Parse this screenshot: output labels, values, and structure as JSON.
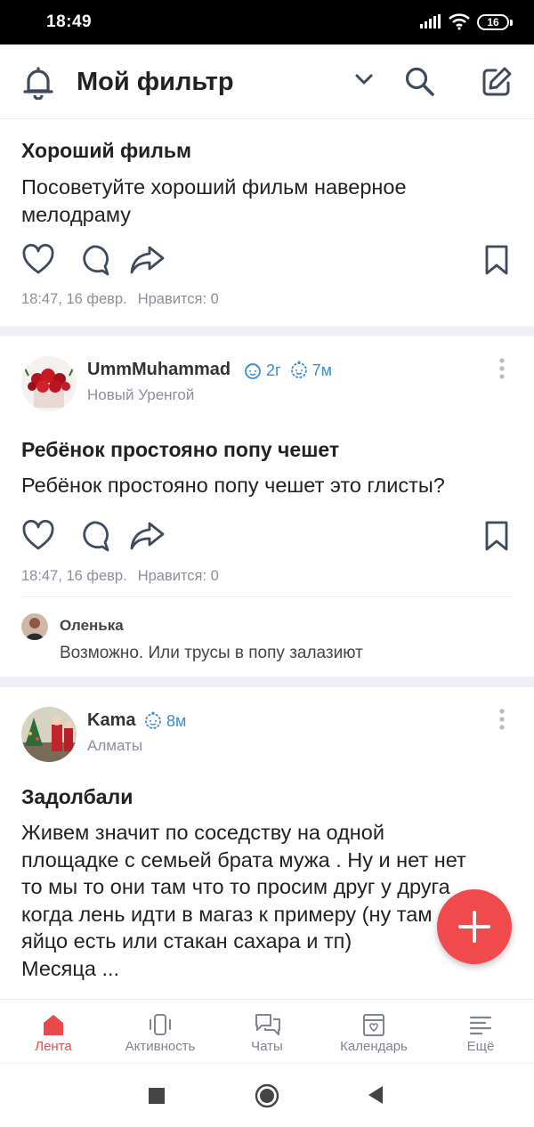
{
  "status_bar": {
    "time": "18:49",
    "battery": "16"
  },
  "header": {
    "title": "Мой фильтр"
  },
  "posts": [
    {
      "title": "Хороший фильм",
      "text": [
        "Посоветуйте хороший фильм наверное",
        "мелодраму"
      ],
      "date": "18:47, 16 февр.",
      "likes": "Нравится: 0"
    },
    {
      "author": "UmmMuhammad",
      "badge1": "2г",
      "badge2": "7м",
      "city": "Новый Уренгой",
      "title": "Ребёнок простояно попу чешет",
      "text": [
        "Ребёнок простояно попу чешет это глисты?"
      ],
      "date": "18:47, 16 февр.",
      "likes": "Нравится: 0",
      "comment": {
        "author": "Оленька",
        "text": "Возможно. Или трусы в попу залазиют"
      }
    },
    {
      "author": "Kama",
      "badge1": "8м",
      "city": "Алматы",
      "title": "Задолбали",
      "text": [
        "Живем значит по соседству на одной",
        "площадке с семьей брата мужа . Ну и нет нет",
        "то мы то они там что то просим друг у друга",
        "когда лень идти в магаз к примеру (ну там",
        "яйцо есть или стакан сахара и тп)",
        "Месяца ..."
      ]
    }
  ],
  "tabs": [
    {
      "label": "Лента",
      "icon": "home-icon"
    },
    {
      "label": "Активность",
      "icon": "activity-icon"
    },
    {
      "label": "Чаты",
      "icon": "chats-icon"
    },
    {
      "label": "Календарь",
      "icon": "calendar-icon"
    },
    {
      "label": "Ещё",
      "icon": "more-icon"
    }
  ],
  "colors": {
    "accent": "#e8494b",
    "fab": "#f04a4c",
    "badge": "#3a8ed8",
    "icon": "#3f4a5e"
  }
}
